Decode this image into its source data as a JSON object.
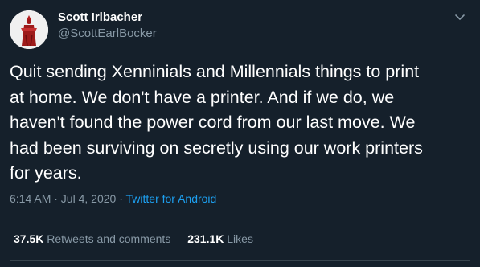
{
  "user": {
    "name": "Scott Irlbacher",
    "handle": "@ScottEarlBocker"
  },
  "tweet": {
    "text": "Quit sending Xenninials and Millennials things to print\nat home. We don't have a printer. And if we do, we\nhaven't found the power cord from our last move. We\nhad been surviving on secretly using our work printers\nfor years.",
    "timestamp": "6:14 AM · Jul 4, 2020 · ",
    "source": "Twitter for Android"
  },
  "stats": {
    "retweets_count": "37.5K",
    "retweets_label": "Retweets and comments",
    "likes_count": "231.1K",
    "likes_label": "Likes"
  },
  "colors": {
    "background": "#15202b",
    "secondary_text": "#8899a6",
    "link": "#1da1f2",
    "divider": "#38444d"
  },
  "icons": {
    "caret": "chevron-down-icon",
    "avatar": "profile-avatar-image"
  }
}
